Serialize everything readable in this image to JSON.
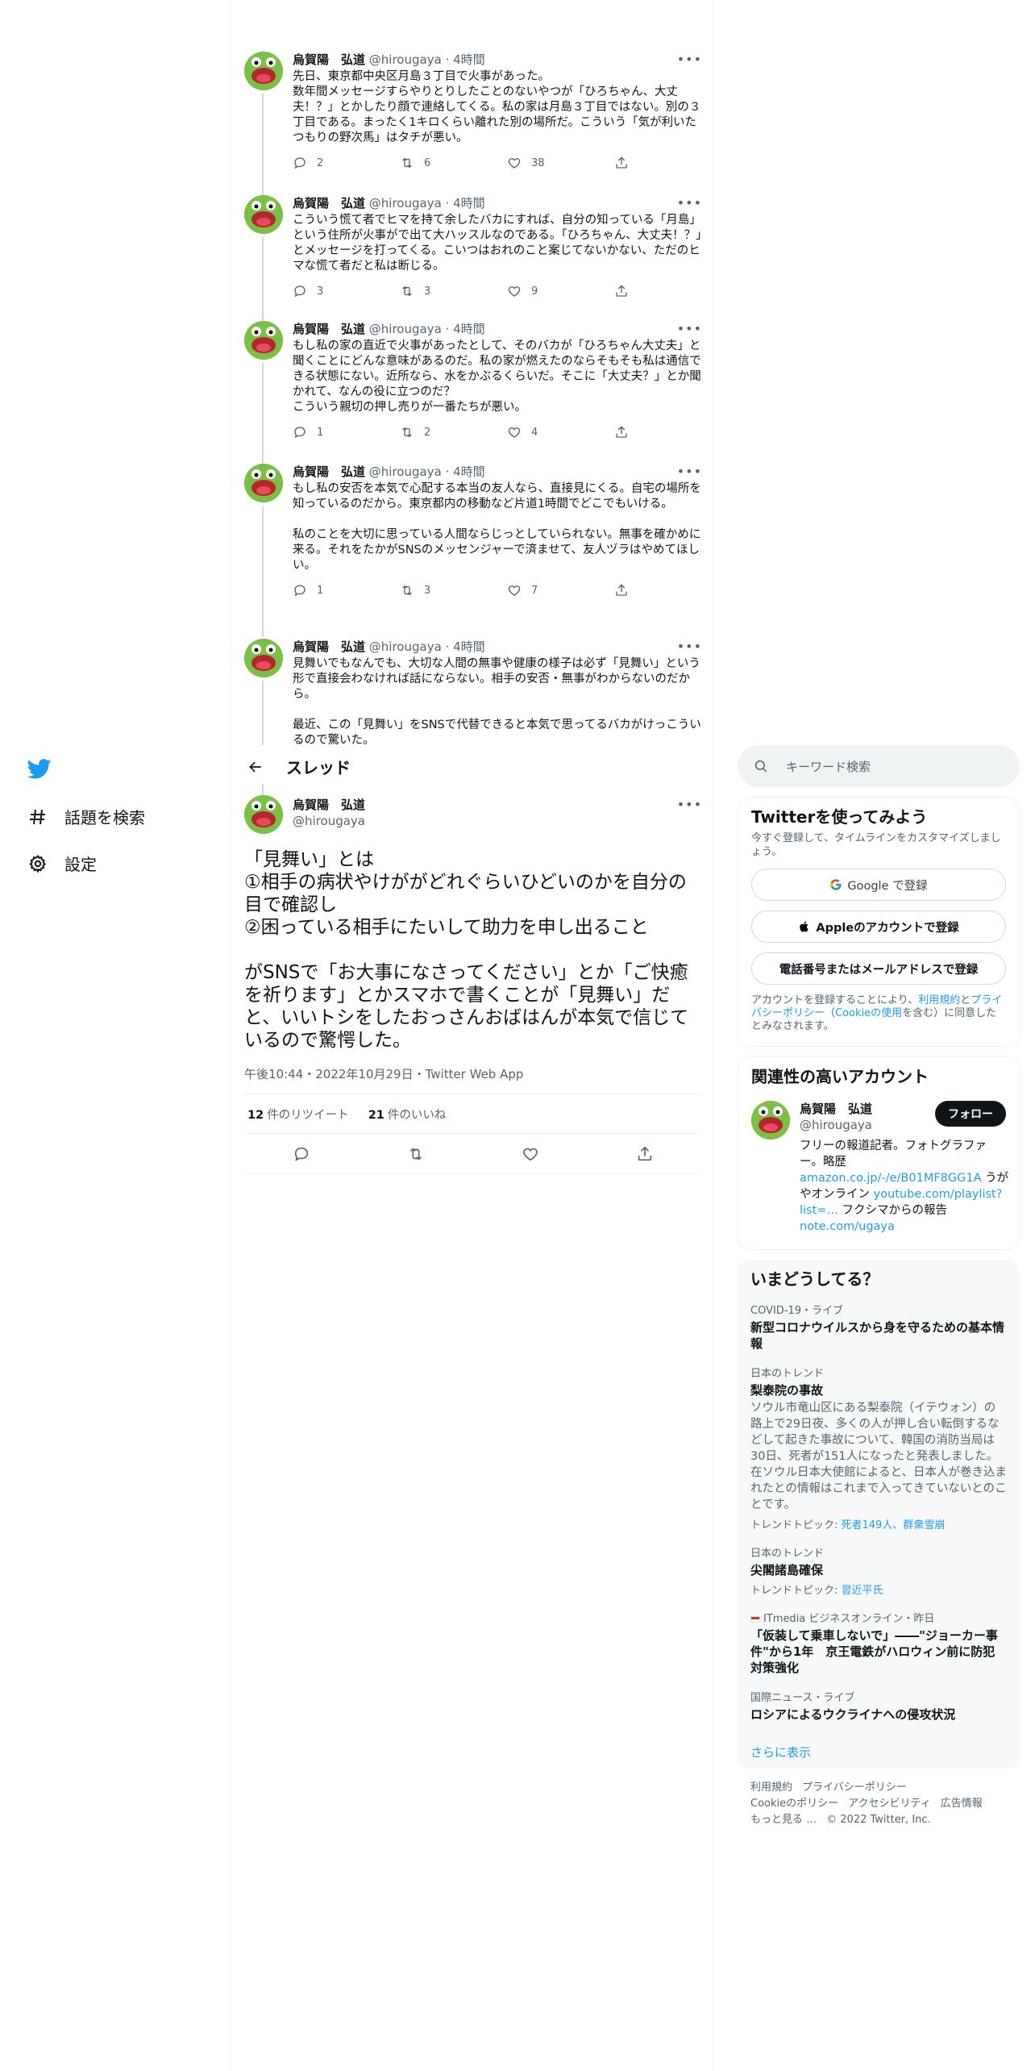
{
  "nav": {
    "explore_label": "話題を検索",
    "settings_label": "設定"
  },
  "user": {
    "name": "烏賀陽　弘道",
    "handle": "@hirougaya"
  },
  "thread_tweets": [
    {
      "name": "烏賀陽　弘道",
      "handle": "@hirougaya",
      "time": "· 4時間",
      "text": "先日、東京都中央区月島３丁目で火事があった。\n数年間メッセージすらやりとりしたことのないやつが「ひろちゃん、大丈夫！？」とかしたり顔で連絡してくる。私の家は月島３丁目ではない。別の３丁目である。まったく1キロくらい離れた別の場所だ。こういう「気が利いたつもりの野次馬」はタチが悪い。",
      "replies": "2",
      "retweets": "6",
      "likes": "38"
    },
    {
      "name": "烏賀陽　弘道",
      "handle": "@hirougaya",
      "time": "· 4時間",
      "text": "こういう慌て者でヒマを持て余したバカにすれば、自分の知っている「月島」という住所が火事がで出て大ハッスルなのである。「ひろちゃん、大丈夫！？」とメッセージを打ってくる。こいつはおれのこと案じてないかない、ただのヒマな慌て者だと私は断じる。",
      "replies": "3",
      "retweets": "3",
      "likes": "9"
    },
    {
      "name": "烏賀陽　弘道",
      "handle": "@hirougaya",
      "time": "· 4時間",
      "text": "もし私の家の直近で火事があったとして、そのバカが「ひろちゃん大丈夫」と聞くことにどんな意味があるのだ。私の家が燃えたのならそもそも私は通信できる状態にない。近所なら、水をかぶるくらいだ。そこに「大丈夫？」とか聞かれて、なんの役に立つのだ？\nこういう親切の押し売りが一番たちが悪い。",
      "replies": "1",
      "retweets": "2",
      "likes": "4"
    },
    {
      "name": "烏賀陽　弘道",
      "handle": "@hirougaya",
      "time": "· 4時間",
      "text": "もし私の安否を本気で心配する本当の友人なら、直接見にくる。自宅の場所を知っているのだから。東京都内の移動など片道1時間でどこでもいける。\n\n私のことを大切に思っている人間ならじっとしていられない。無事を確かめに来る。それをたかがSNSのメッセンジャーで済ませて、友人ヅラはやめてほしい。",
      "replies": "1",
      "retweets": "3",
      "likes": "7"
    },
    {
      "name": "烏賀陽　弘道",
      "handle": "@hirougaya",
      "time": "· 4時間",
      "text": "見舞いでもなんでも、大切な人間の無事や健康の様子は必ず「見舞い」という形で直接会わなければ話にならない。相手の安否・無事がわからないのだから。\n\n最近、この「見舞い」をSNSで代替できると本気で思ってるバカがけっこういるので驚いた。"
    }
  ],
  "header": {
    "title": "スレッド"
  },
  "main_tweet": {
    "text": "「見舞い」とは\n①相手の病状やけががどれぐらいひどいのかを自分の目で確認し\n②困っている相手にたいして助力を申し出ること\n\nがSNSで「お大事になさってください」とか「ご快癒を祈ります」とかスマホで書くことが「見舞い」だと、いいトシをしたおっさんおばはんが本気で信じているので驚愕した。",
    "meta": "午後10:44・2022年10月29日・Twitter Web App",
    "retweet_count": "12",
    "retweet_label": "件のリツイート",
    "like_count": "21",
    "like_label": "件のいいね"
  },
  "search": {
    "placeholder": "キーワード検索"
  },
  "signup": {
    "title": "Twitterを使ってみよう",
    "subtitle": "今すぐ登録して、タイムラインをカスタマイズしましょう。",
    "google_label": "Google で登録",
    "apple_label": "Appleのアカウントで登録",
    "phone_label": "電話番号またはメールアドレスで登録",
    "legal_prefix": "アカウントを登録することにより、",
    "legal_terms": "利用規約",
    "legal_and": "と",
    "legal_privacy": "プライバシーポリシー",
    "legal_paren_open": "（",
    "legal_cookie": "Cookieの使用",
    "legal_suffix": "を含む）に同意したとみなされます。"
  },
  "related": {
    "title": "関連性の高いアカウント",
    "follow_label": "フォロー",
    "bio_text1": "フリーの報道記者。フォトグラファー。略歴",
    "bio_link1": "amazon.co.jp/-/e/B01MF8GG1A",
    "bio_text2": " うがやオンライン ",
    "bio_link2": "youtube.com/playlist?list=…",
    "bio_text3": " フクシマからの報告 ",
    "bio_link3": "note.com/ugaya"
  },
  "trends": {
    "title": "いまどうしてる？",
    "items": [
      {
        "context": "COVID-19・ライブ",
        "title": "新型コロナウイルスから身を守るための基本情報"
      },
      {
        "context": "日本のトレンド",
        "title": "梨泰院の事故",
        "desc": "ソウル市竜山区にある梨泰院（イテウォン）の路上で29日夜、多くの人が押し合い転倒するなどして起きた事故について、韓国の消防当局は30日、死者が151人になったと発表しました。在ソウル日本大使館によると、日本人が巻き込まれたとの情報はこれまで入ってきていないとのことです。",
        "topics_label": "トレンドトピック: ",
        "topics": "死者149人、群衆雪崩"
      },
      {
        "context": "日本のトレンド",
        "title": "尖閣諸島確保",
        "topics_label": "トレンドトピック: ",
        "topics": "習近平氏"
      },
      {
        "context": "ITmedia ビジネスオンライン・昨日",
        "title": "「仮装して乗車しないで」――\"ジョーカー事件\"から1年　京王電鉄がハロウィン前に防犯対策強化"
      },
      {
        "context": "国際ニュース・ライブ",
        "title": "ロシアによるウクライナへの侵攻状況"
      }
    ],
    "show_more": "さらに表示"
  },
  "footer": {
    "terms": "利用規約",
    "privacy": "プライバシーポリシー",
    "cookie": "Cookieのポリシー",
    "accessibility": "アクセシビリティ",
    "ads": "広告情報",
    "more": "もっと見る …",
    "copyright": "© 2022 Twitter, Inc."
  },
  "colors": {
    "accent": "#1d9bf0",
    "text": "#0f1419",
    "secondary": "#536471",
    "border": "#eff3f4"
  }
}
